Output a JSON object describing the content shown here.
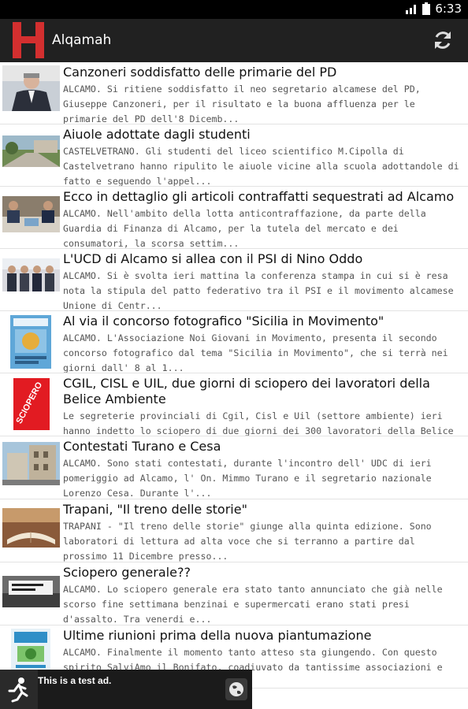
{
  "status": {
    "time": "6:33"
  },
  "app": {
    "title": "Alqamah",
    "logo_letter": "H",
    "accent": "#d32f2f"
  },
  "articles": [
    {
      "title": "Canzoneri soddisfatto delle primarie del PD",
      "snippet": "ALCAMO. Si ritiene soddisfatto il neo segretario alcamese del PD, Giuseppe Canzoneri, per il risultato e la buona affluenza per le primarie del PD dell'8 Dicemb..."
    },
    {
      "title": "Aiuole adottate dagli studenti",
      "snippet": "CASTELVETRANO. Gli studenti del liceo scientifico M.Cipolla di Castelvetrano hanno ripulito le aiuole vicine alla scuola adottandole di fatto e seguendo l'appel..."
    },
    {
      "title": "Ecco in dettaglio gli articoli contraffatti sequestrati ad Alcamo",
      "snippet": "ALCAMO. Nell'ambito della lotta anticontraffazione, da parte della Guardia di Finanza di Alcamo, per la tutela del mercato e dei consumatori,  la scorsa settim..."
    },
    {
      "title": "L'UCD di Alcamo si allea con il PSI di Nino Oddo",
      "snippet": "ALCAMO. Si è svolta ieri mattina la conferenza stampa in cui si è resa nota la stipula del patto federativo tra il PSI e il movimento alcamese Unione di Centr..."
    },
    {
      "title": "Al via il concorso fotografico \"Sicilia in Movimento\"",
      "snippet": "ALCAMO. L'Associazione Noi Giovani in Movimento, presenta il secondo concorso fotografico dal tema \"Sicilia in Movimento\", che si terrà nei giorni dall' 8 al 1..."
    },
    {
      "title": "CGIL, CISL e UIL, due giorni di sciopero dei lavoratori della Belice Ambiente",
      "snippet": "Le segreterie provinciali di Cgil, Cisl e Uil (settore ambiente) ieri hanno indetto lo sciopero di due giorni dei 300 lavoratori della Belice Ambiente SpA. I di..."
    },
    {
      "title": "Contestati Turano e Cesa",
      "snippet": "ALCAMO. Sono stati contestati, durante l'incontro dell' UDC di ieri pomeriggio ad Alcamo, l' On. Mimmo Turano e il segretario nazionale Lorenzo Cesa. Durante l'..."
    },
    {
      "title": "Trapani, \"Il treno delle storie\"",
      "snippet": "TRAPANI - \"Il treno delle storie\" giunge alla quinta edizione. Sono laboratori di lettura ad alta voce che si terranno a partire dal prossimo 11 Dicembre presso..."
    },
    {
      "title": "Sciopero generale??",
      "snippet": "ALCAMO. Lo sciopero generale era stato tanto annunciato che già nelle scorso fine settimana benzinai e supermercati erano stati presi d'assalto. Tra venerdi e..."
    },
    {
      "title": "Ultime riunioni prima della nuova piantumazione",
      "snippet": "ALCAMO. Finalmente il momento tanto atteso sta giungendo. Con questo spirito SalviAmo il Bonifato, coadiuvato da tantissime associazioni e molti liberi cittadin..."
    }
  ],
  "thumb_texts": {
    "sciopero": "SCIOPERO"
  },
  "ad": {
    "text": "This is a test ad."
  }
}
